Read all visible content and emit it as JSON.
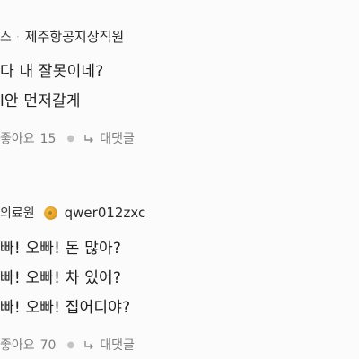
{
  "comments": [
    {
      "author_fragment": "스",
      "nickname": "제주항공지상직원",
      "lines": [
        "다 내 잘못이네?",
        "l안 먼저갈게"
      ],
      "like_label": "좋아요",
      "like_count": "15",
      "reply_label": "대댓글"
    },
    {
      "author_fragment": "의료원",
      "nickname": "qwer012zxc",
      "lines": [
        "빠! 오빠! 돈 많아?",
        "빠! 오빠! 차 있어?",
        "빠! 오빠! 집어디야?"
      ],
      "like_label": "좋아요",
      "like_count": "70",
      "reply_label": "대댓글"
    }
  ]
}
